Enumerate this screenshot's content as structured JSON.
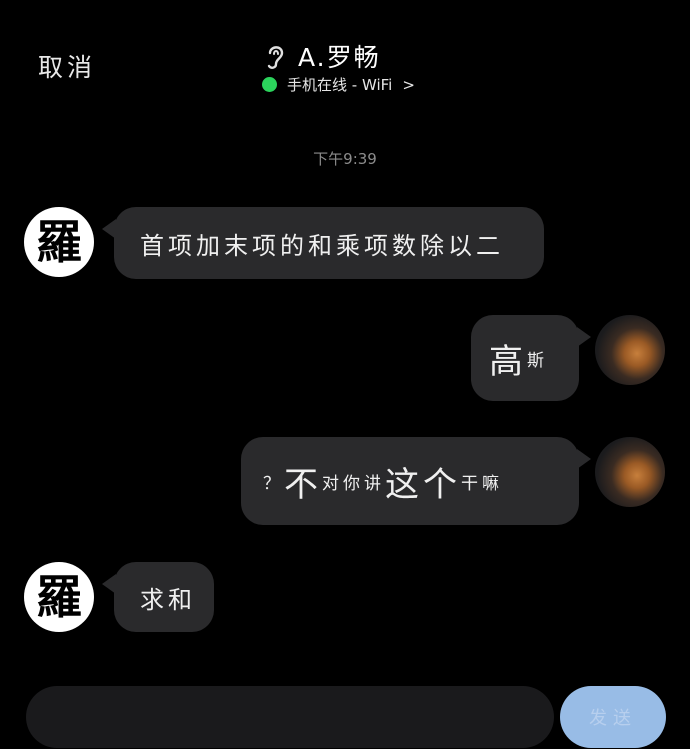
{
  "header": {
    "cancel_label": "取消",
    "contact_name": "A.罗畅",
    "status_text": "手机在线 - WiFi",
    "chevron": ">"
  },
  "timestamp": "下午9:39",
  "avatars": {
    "contact_char": "羅"
  },
  "messages": [
    {
      "side": "left",
      "text": "首项加末项的和乘项数除以二"
    },
    {
      "side": "right",
      "parts": [
        "高",
        "斯"
      ]
    },
    {
      "side": "right",
      "parts": [
        "？",
        "不",
        "对你讲",
        "这个",
        "干嘛"
      ]
    },
    {
      "side": "left",
      "text": "求和"
    }
  ],
  "composer": {
    "send_label": "发送"
  },
  "colors": {
    "background": "#000000",
    "bubble": "#2a2a2c",
    "online": "#2bd35c",
    "send_button": "#98bce6"
  }
}
